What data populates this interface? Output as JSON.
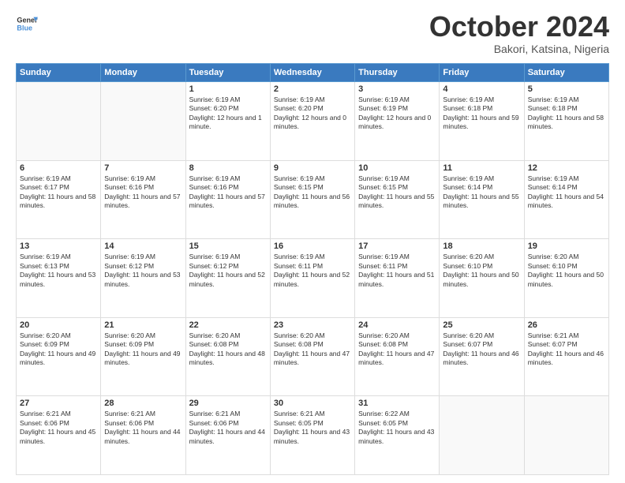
{
  "header": {
    "logo_line1": "General",
    "logo_line2": "Blue",
    "month": "October 2024",
    "location": "Bakori, Katsina, Nigeria"
  },
  "days_of_week": [
    "Sunday",
    "Monday",
    "Tuesday",
    "Wednesday",
    "Thursday",
    "Friday",
    "Saturday"
  ],
  "weeks": [
    [
      {
        "day": "",
        "sunrise": "",
        "sunset": "",
        "daylight": ""
      },
      {
        "day": "",
        "sunrise": "",
        "sunset": "",
        "daylight": ""
      },
      {
        "day": "1",
        "sunrise": "Sunrise: 6:19 AM",
        "sunset": "Sunset: 6:20 PM",
        "daylight": "Daylight: 12 hours and 1 minute."
      },
      {
        "day": "2",
        "sunrise": "Sunrise: 6:19 AM",
        "sunset": "Sunset: 6:20 PM",
        "daylight": "Daylight: 12 hours and 0 minutes."
      },
      {
        "day": "3",
        "sunrise": "Sunrise: 6:19 AM",
        "sunset": "Sunset: 6:19 PM",
        "daylight": "Daylight: 12 hours and 0 minutes."
      },
      {
        "day": "4",
        "sunrise": "Sunrise: 6:19 AM",
        "sunset": "Sunset: 6:18 PM",
        "daylight": "Daylight: 11 hours and 59 minutes."
      },
      {
        "day": "5",
        "sunrise": "Sunrise: 6:19 AM",
        "sunset": "Sunset: 6:18 PM",
        "daylight": "Daylight: 11 hours and 58 minutes."
      }
    ],
    [
      {
        "day": "6",
        "sunrise": "Sunrise: 6:19 AM",
        "sunset": "Sunset: 6:17 PM",
        "daylight": "Daylight: 11 hours and 58 minutes."
      },
      {
        "day": "7",
        "sunrise": "Sunrise: 6:19 AM",
        "sunset": "Sunset: 6:16 PM",
        "daylight": "Daylight: 11 hours and 57 minutes."
      },
      {
        "day": "8",
        "sunrise": "Sunrise: 6:19 AM",
        "sunset": "Sunset: 6:16 PM",
        "daylight": "Daylight: 11 hours and 57 minutes."
      },
      {
        "day": "9",
        "sunrise": "Sunrise: 6:19 AM",
        "sunset": "Sunset: 6:15 PM",
        "daylight": "Daylight: 11 hours and 56 minutes."
      },
      {
        "day": "10",
        "sunrise": "Sunrise: 6:19 AM",
        "sunset": "Sunset: 6:15 PM",
        "daylight": "Daylight: 11 hours and 55 minutes."
      },
      {
        "day": "11",
        "sunrise": "Sunrise: 6:19 AM",
        "sunset": "Sunset: 6:14 PM",
        "daylight": "Daylight: 11 hours and 55 minutes."
      },
      {
        "day": "12",
        "sunrise": "Sunrise: 6:19 AM",
        "sunset": "Sunset: 6:14 PM",
        "daylight": "Daylight: 11 hours and 54 minutes."
      }
    ],
    [
      {
        "day": "13",
        "sunrise": "Sunrise: 6:19 AM",
        "sunset": "Sunset: 6:13 PM",
        "daylight": "Daylight: 11 hours and 53 minutes."
      },
      {
        "day": "14",
        "sunrise": "Sunrise: 6:19 AM",
        "sunset": "Sunset: 6:12 PM",
        "daylight": "Daylight: 11 hours and 53 minutes."
      },
      {
        "day": "15",
        "sunrise": "Sunrise: 6:19 AM",
        "sunset": "Sunset: 6:12 PM",
        "daylight": "Daylight: 11 hours and 52 minutes."
      },
      {
        "day": "16",
        "sunrise": "Sunrise: 6:19 AM",
        "sunset": "Sunset: 6:11 PM",
        "daylight": "Daylight: 11 hours and 52 minutes."
      },
      {
        "day": "17",
        "sunrise": "Sunrise: 6:19 AM",
        "sunset": "Sunset: 6:11 PM",
        "daylight": "Daylight: 11 hours and 51 minutes."
      },
      {
        "day": "18",
        "sunrise": "Sunrise: 6:20 AM",
        "sunset": "Sunset: 6:10 PM",
        "daylight": "Daylight: 11 hours and 50 minutes."
      },
      {
        "day": "19",
        "sunrise": "Sunrise: 6:20 AM",
        "sunset": "Sunset: 6:10 PM",
        "daylight": "Daylight: 11 hours and 50 minutes."
      }
    ],
    [
      {
        "day": "20",
        "sunrise": "Sunrise: 6:20 AM",
        "sunset": "Sunset: 6:09 PM",
        "daylight": "Daylight: 11 hours and 49 minutes."
      },
      {
        "day": "21",
        "sunrise": "Sunrise: 6:20 AM",
        "sunset": "Sunset: 6:09 PM",
        "daylight": "Daylight: 11 hours and 49 minutes."
      },
      {
        "day": "22",
        "sunrise": "Sunrise: 6:20 AM",
        "sunset": "Sunset: 6:08 PM",
        "daylight": "Daylight: 11 hours and 48 minutes."
      },
      {
        "day": "23",
        "sunrise": "Sunrise: 6:20 AM",
        "sunset": "Sunset: 6:08 PM",
        "daylight": "Daylight: 11 hours and 47 minutes."
      },
      {
        "day": "24",
        "sunrise": "Sunrise: 6:20 AM",
        "sunset": "Sunset: 6:08 PM",
        "daylight": "Daylight: 11 hours and 47 minutes."
      },
      {
        "day": "25",
        "sunrise": "Sunrise: 6:20 AM",
        "sunset": "Sunset: 6:07 PM",
        "daylight": "Daylight: 11 hours and 46 minutes."
      },
      {
        "day": "26",
        "sunrise": "Sunrise: 6:21 AM",
        "sunset": "Sunset: 6:07 PM",
        "daylight": "Daylight: 11 hours and 46 minutes."
      }
    ],
    [
      {
        "day": "27",
        "sunrise": "Sunrise: 6:21 AM",
        "sunset": "Sunset: 6:06 PM",
        "daylight": "Daylight: 11 hours and 45 minutes."
      },
      {
        "day": "28",
        "sunrise": "Sunrise: 6:21 AM",
        "sunset": "Sunset: 6:06 PM",
        "daylight": "Daylight: 11 hours and 44 minutes."
      },
      {
        "day": "29",
        "sunrise": "Sunrise: 6:21 AM",
        "sunset": "Sunset: 6:06 PM",
        "daylight": "Daylight: 11 hours and 44 minutes."
      },
      {
        "day": "30",
        "sunrise": "Sunrise: 6:21 AM",
        "sunset": "Sunset: 6:05 PM",
        "daylight": "Daylight: 11 hours and 43 minutes."
      },
      {
        "day": "31",
        "sunrise": "Sunrise: 6:22 AM",
        "sunset": "Sunset: 6:05 PM",
        "daylight": "Daylight: 11 hours and 43 minutes."
      },
      {
        "day": "",
        "sunrise": "",
        "sunset": "",
        "daylight": ""
      },
      {
        "day": "",
        "sunrise": "",
        "sunset": "",
        "daylight": ""
      }
    ]
  ]
}
